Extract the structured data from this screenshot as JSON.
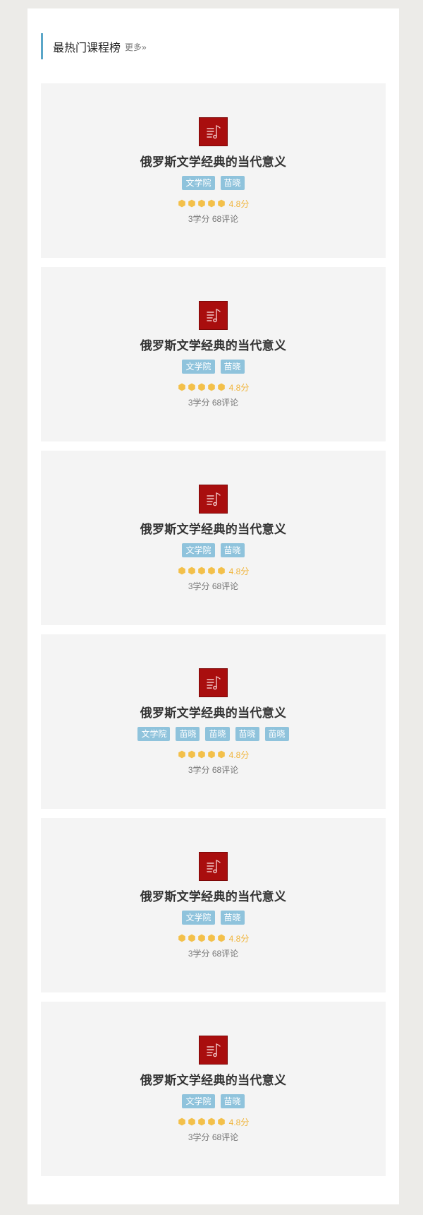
{
  "header": {
    "title": "最热门课程榜",
    "more_label": "更多»"
  },
  "courses": [
    {
      "title": "俄罗斯文学经典的当代意义",
      "tags": [
        "文学院",
        "苗晓"
      ],
      "score": "4.8分",
      "meta": "3学分 68评论"
    },
    {
      "title": "俄罗斯文学经典的当代意义",
      "tags": [
        "文学院",
        "苗晓"
      ],
      "score": "4.8分",
      "meta": "3学分 68评论"
    },
    {
      "title": "俄罗斯文学经典的当代意义",
      "tags": [
        "文学院",
        "苗晓"
      ],
      "score": "4.8分",
      "meta": "3学分 68评论"
    },
    {
      "title": "俄罗斯文学经典的当代意义",
      "tags": [
        "文学院",
        "苗晓",
        "苗晓",
        "苗晓",
        "苗晓"
      ],
      "score": "4.8分",
      "meta": "3学分 68评论"
    },
    {
      "title": "俄罗斯文学经典的当代意义",
      "tags": [
        "文学院",
        "苗晓"
      ],
      "score": "4.8分",
      "meta": "3学分 68评论"
    },
    {
      "title": "俄罗斯文学经典的当代意义",
      "tags": [
        "文学院",
        "苗晓"
      ],
      "score": "4.8分",
      "meta": "3学分 68评论"
    }
  ],
  "colors": {
    "accent": "#5aa6c8",
    "tag_bg": "#8fc3dc",
    "cover_bg": "#a90e0e",
    "star": "#f0b43a"
  },
  "icons": {
    "cover": "music-note-list-icon",
    "star": "star-icon"
  }
}
